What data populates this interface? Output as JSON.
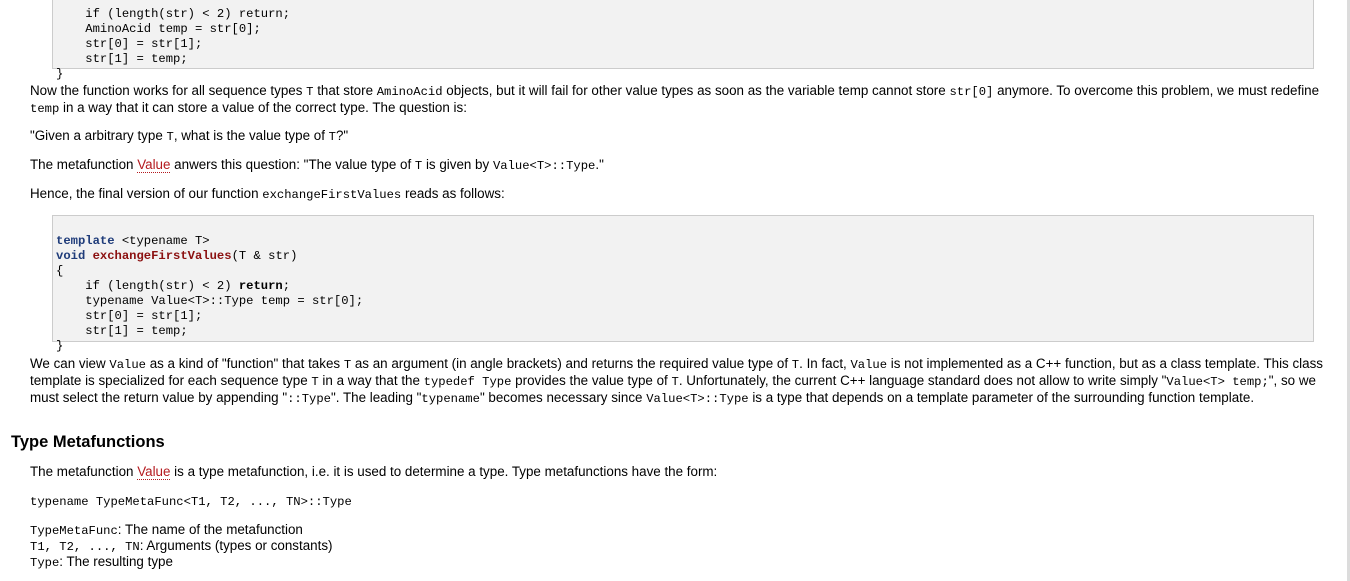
{
  "code_block_1": {
    "lines": [
      "    if (length(str) < 2) return;",
      "    AminoAcid temp = str[0];",
      "    str[0] = str[1];",
      "    str[1] = temp;",
      "}"
    ]
  },
  "para1": {
    "a": "Now the function works for all sequence types ",
    "t1": "T",
    "b": " that store ",
    "aa": "AminoAcid",
    "c": " objects, but it will fail for other value types as soon as the variable temp cannot store ",
    "s0": "str[0]",
    "d": " anymore. To overcome this problem, we must redefine ",
    "temp": "temp",
    "e": " in a way that it can store a value of the correct type. The question is:"
  },
  "quote": {
    "a": "\"Given a arbitrary type ",
    "t": "T",
    "b": ", what is the value type of ",
    "t2": "T",
    "c": "?\""
  },
  "para2": {
    "a": "The metafunction ",
    "link": "Value",
    "b": " anwers this question: \"The value type of ",
    "t": "T",
    "c": " is given by ",
    "code": "Value<T>::Type",
    "d": ".\""
  },
  "para3": {
    "a": "Hence, the final version of our function ",
    "code": "exchangeFirstValues",
    "b": " reads as follows:"
  },
  "code_block_2": {
    "l1_kw": "template",
    "l1_rest": " <typename T>",
    "l2_kw": "void",
    "l2_sp": " ",
    "l2_fn": "exchangeFirstValues",
    "l2_rest": "(T & str)",
    "l3": "{",
    "l4_a": "    if (length(str) < 2) ",
    "l4_kw": "return",
    "l4_b": ";",
    "l5": "    typename Value<T>::Type temp = str[0];",
    "l6": "    str[0] = str[1];",
    "l7": "    str[1] = temp;",
    "l8": "}"
  },
  "para4": {
    "a": "We can view ",
    "v1": "Value",
    "b": " as a kind of \"function\" that takes ",
    "t1": "T",
    "c": " as an argument (in angle brackets) and returns the required value type of ",
    "t2": "T",
    "d": ". In fact, ",
    "v2": "Value",
    "e": " is not implemented as a C++ function, but as a class template. This class template is specialized for each sequence type ",
    "t3": "T",
    "f": " in a way that the ",
    "td": "typedef Type",
    "g": " provides the value type of ",
    "t4": "T",
    "h": ". Unfortunately, the current C++ language standard does not allow to write simply \"",
    "vt": "Value<T> temp;",
    "i": "\", so we must select the return value by appending \"",
    "ct": "::Type",
    "j": "\". The leading \"",
    "tn": "typename",
    "k": "\" becomes necessary since ",
    "vtt": "Value<T>::Type",
    "l": " is a type that depends on a template parameter of the surrounding function template."
  },
  "heading": "Type Metafunctions",
  "para5": {
    "a": "The metafunction ",
    "link": "Value",
    "b": " is a type metafunction, i.e. it is used to determine a type. Type metafunctions have the form:"
  },
  "form_line": "typename TypeMetaFunc<T1, T2, ..., TN>::Type",
  "defs": [
    {
      "term": "TypeMetaFunc",
      "desc": ": The name of the metafunction"
    },
    {
      "term": "T1, T2, ..., TN",
      "desc": ": Arguments (types or constants)"
    },
    {
      "term": "Type",
      "desc": ": The resulting type"
    }
  ],
  "colors": {
    "keyword": "#1f3c7a",
    "function": "#8b1010",
    "link": "#b4191e",
    "code_bg": "#f2f2f2",
    "code_border": "#cccccc"
  }
}
